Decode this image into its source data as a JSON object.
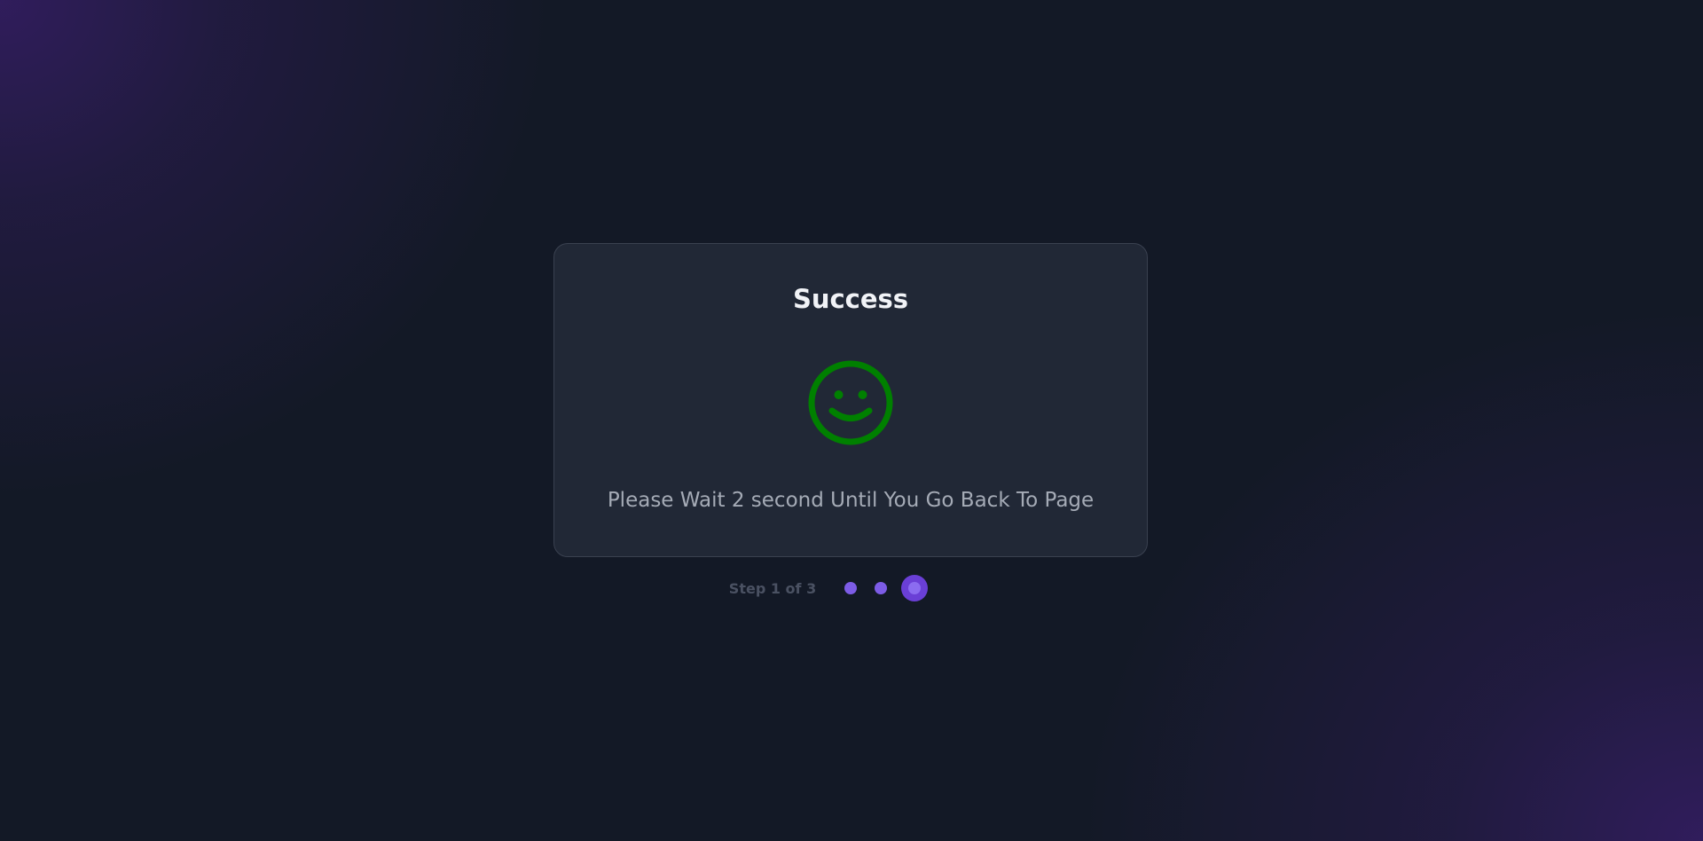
{
  "dialog": {
    "title": "Success",
    "icon": "smiley-icon",
    "icon_color": "#008000",
    "message": "Please Wait 2 second Until You Go Back To Page"
  },
  "stepper": {
    "label": "Step 1 of 3",
    "current_step": 3,
    "total_steps": 3,
    "accent_color": "#7d5ce6"
  }
}
